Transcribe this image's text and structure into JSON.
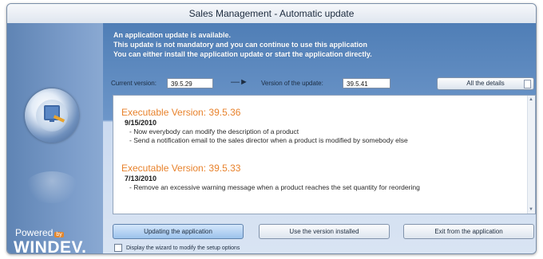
{
  "window": {
    "title": "Sales Management - Automatic update"
  },
  "info": {
    "line1": "An application update is available.",
    "line2": "This update is not mandatory and you can continue to use this application",
    "line3": "You can either install the application update or start the application directly."
  },
  "versions": {
    "current_label": "Current version:",
    "current_value": "39.5.29",
    "update_label": "Version of the update:",
    "update_value": "39.5.41",
    "details_button": "All the details"
  },
  "notes": {
    "releases": [
      {
        "title": "Executable Version: 39.5.36",
        "date": "9/15/2010",
        "items": [
          "- Now everybody can modify the description of a product",
          "- Send a notification email to the sales director when a product is modified by somebody else"
        ]
      },
      {
        "title": "Executable Version: 39.5.33",
        "date": "7/13/2010",
        "items": [
          "- Remove an excessive warning message when a product reaches the set quantity for reordering"
        ]
      }
    ]
  },
  "actions": {
    "update_button": "Updating the application",
    "use_installed_button": "Use the version installed",
    "exit_button": "Exit from the application"
  },
  "footer": {
    "wizard_checkbox_label": "Display the wizard to modify the setup options"
  },
  "branding": {
    "powered": "Powered",
    "by": "by",
    "product": "WINDEV."
  },
  "colors": {
    "accent_orange": "#e8822c",
    "window_blue": "#4f7eb6"
  }
}
